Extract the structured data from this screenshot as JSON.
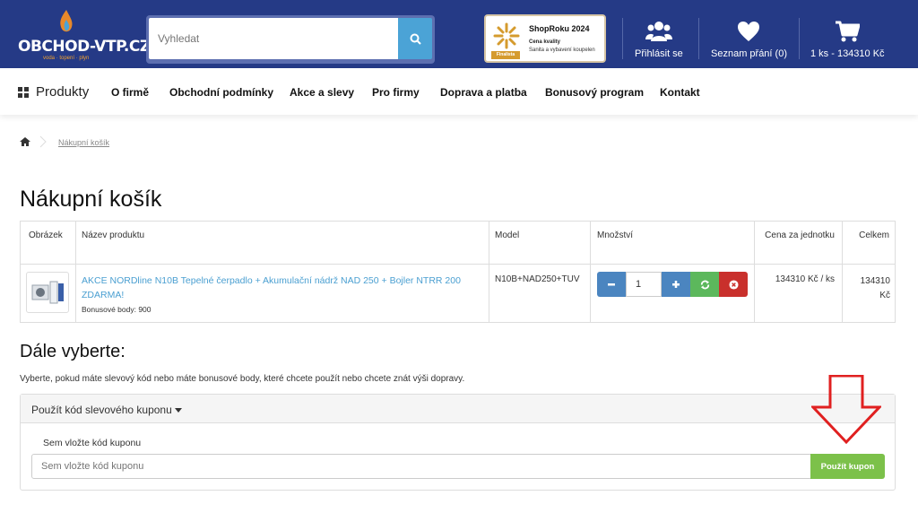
{
  "header": {
    "brand": "OBCHOD-VTP.CZ",
    "tagline": "voda · topení · plyn",
    "search_placeholder": "Vyhledat",
    "badge": {
      "title": "ShopRoku 2024",
      "line1": "Cena kvality",
      "line2": "Sanita a vybavení koupelen",
      "tag": "Finalista"
    },
    "login_label": "Přihlásit se",
    "wishlist_label": "Seznam přání (0)",
    "cart_label": "1 ks - 134310 Kč"
  },
  "nav": {
    "products": "Produkty",
    "items": [
      "O firmě",
      "Obchodní podmínky",
      "Akce a slevy",
      "Pro firmy",
      "Doprava a platba",
      "Bonusový program",
      "Kontakt"
    ]
  },
  "breadcrumb": {
    "current": "Nákupní košík"
  },
  "page_title": "Nákupní košík",
  "cart": {
    "headers": {
      "image": "Obrázek",
      "name": "Název produktu",
      "model": "Model",
      "quantity": "Množství",
      "unit_price": "Cena za jednotku",
      "total": "Celkem"
    },
    "item": {
      "name": "AKCE NORDline N10B Tepelné čerpadlo + Akumulační nádrž NAD 250 + Bojler NTRR 200 ZDARMA!",
      "bonus": "Bonusové body: 900",
      "model": "N10B+NAD250+TUV",
      "quantity": "1",
      "unit_price": "134310 Kč / ks",
      "total": "134310 Kč"
    }
  },
  "more": {
    "title": "Dále vyberte:",
    "hint": "Vyberte, pokud máte slevový kód nebo máte bonusové body, které chcete použít nebo chcete znát výši dopravy.",
    "panel_title": "Použít kód slevového kuponu",
    "coupon_label": "Sem vložte kód kuponu",
    "coupon_placeholder": "Sem vložte kód kuponu",
    "coupon_button": "Použít kupon"
  },
  "colors": {
    "header_bg": "#253a86",
    "link": "#4a9fd1",
    "accent_green": "#7cc14a",
    "annotation_red": "#e02020"
  }
}
